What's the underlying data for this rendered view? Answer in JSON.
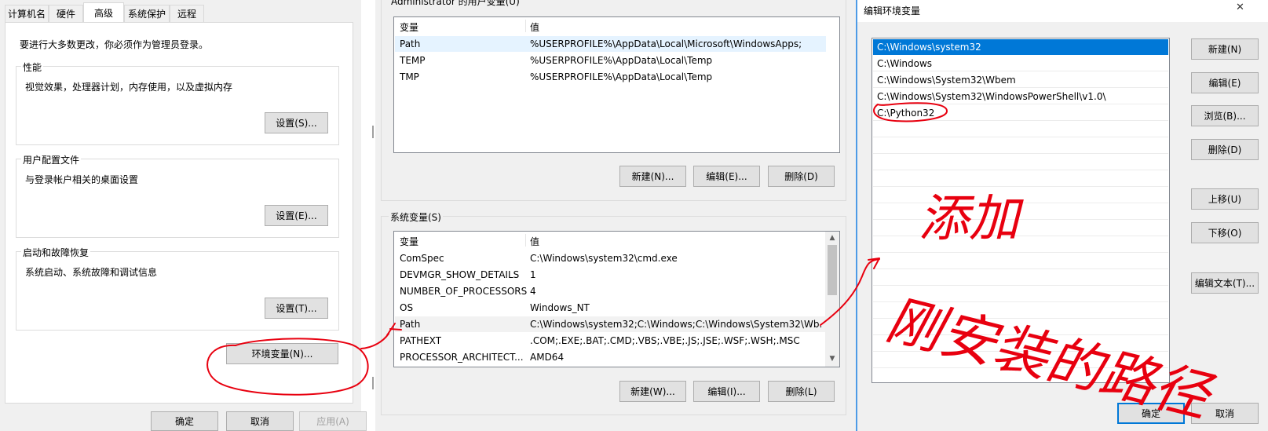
{
  "left": {
    "tabs": [
      "计算机名",
      "硬件",
      "高级",
      "系统保护",
      "远程"
    ],
    "notice": "要进行大多数更改，你必须作为管理员登录。",
    "performance": {
      "title": "性能",
      "desc": "视觉效果，处理器计划，内存使用，以及虚拟内存",
      "button": "设置(S)..."
    },
    "profile": {
      "title": "用户配置文件",
      "desc": "与登录帐户相关的桌面设置",
      "button": "设置(E)..."
    },
    "startup": {
      "title": "启动和故障恢复",
      "desc": "系统启动、系统故障和调试信息",
      "button": "设置(T)..."
    },
    "env_button": "环境变量(N)...",
    "ok": "确定",
    "cancel": "取消",
    "apply": "应用(A)"
  },
  "middle": {
    "user_title": "Administrator 的用户变量(U)",
    "col_var": "变量",
    "col_val": "值",
    "user_vars": [
      {
        "name": "Path",
        "value": "%USERPROFILE%\\AppData\\Local\\Microsoft\\WindowsApps;"
      },
      {
        "name": "TEMP",
        "value": "%USERPROFILE%\\AppData\\Local\\Temp"
      },
      {
        "name": "TMP",
        "value": "%USERPROFILE%\\AppData\\Local\\Temp"
      }
    ],
    "user_new": "新建(N)...",
    "user_edit": "编辑(E)...",
    "user_delete": "删除(D)",
    "sys_title": "系统变量(S)",
    "sys_vars": [
      {
        "name": "ComSpec",
        "value": "C:\\Windows\\system32\\cmd.exe"
      },
      {
        "name": "DEVMGR_SHOW_DETAILS",
        "value": "1"
      },
      {
        "name": "NUMBER_OF_PROCESSORS",
        "value": "4"
      },
      {
        "name": "OS",
        "value": "Windows_NT"
      },
      {
        "name": "Path",
        "value": "C:\\Windows\\system32;C:\\Windows;C:\\Windows\\System32\\Wb..."
      },
      {
        "name": "PATHEXT",
        "value": ".COM;.EXE;.BAT;.CMD;.VBS;.VBE;.JS;.JSE;.WSF;.WSH;.MSC"
      },
      {
        "name": "PROCESSOR_ARCHITECT...",
        "value": "AMD64"
      }
    ],
    "sys_new": "新建(W)...",
    "sys_edit": "编辑(I)...",
    "sys_delete": "删除(L)"
  },
  "right": {
    "title": "编辑环境变量",
    "close": "✕",
    "paths": [
      "C:\\Windows\\system32",
      "C:\\Windows",
      "C:\\Windows\\System32\\Wbem",
      "C:\\Windows\\System32\\WindowsPowerShell\\v1.0\\",
      "C:\\Python32"
    ],
    "buttons": {
      "new": "新建(N)",
      "edit": "编辑(E)",
      "browse": "浏览(B)...",
      "delete": "删除(D)",
      "up": "上移(U)",
      "down": "下移(O)",
      "edit_text": "编辑文本(T)..."
    },
    "ok": "确定",
    "cancel": "取消"
  },
  "annotations": {
    "add": "添加",
    "path_note": "刚安装的路径",
    "ink_color": "#e8000f"
  },
  "colors": {
    "selection": "#0078d7",
    "button_bg": "#e1e1e1",
    "title_bar": "#f0f0f0"
  }
}
